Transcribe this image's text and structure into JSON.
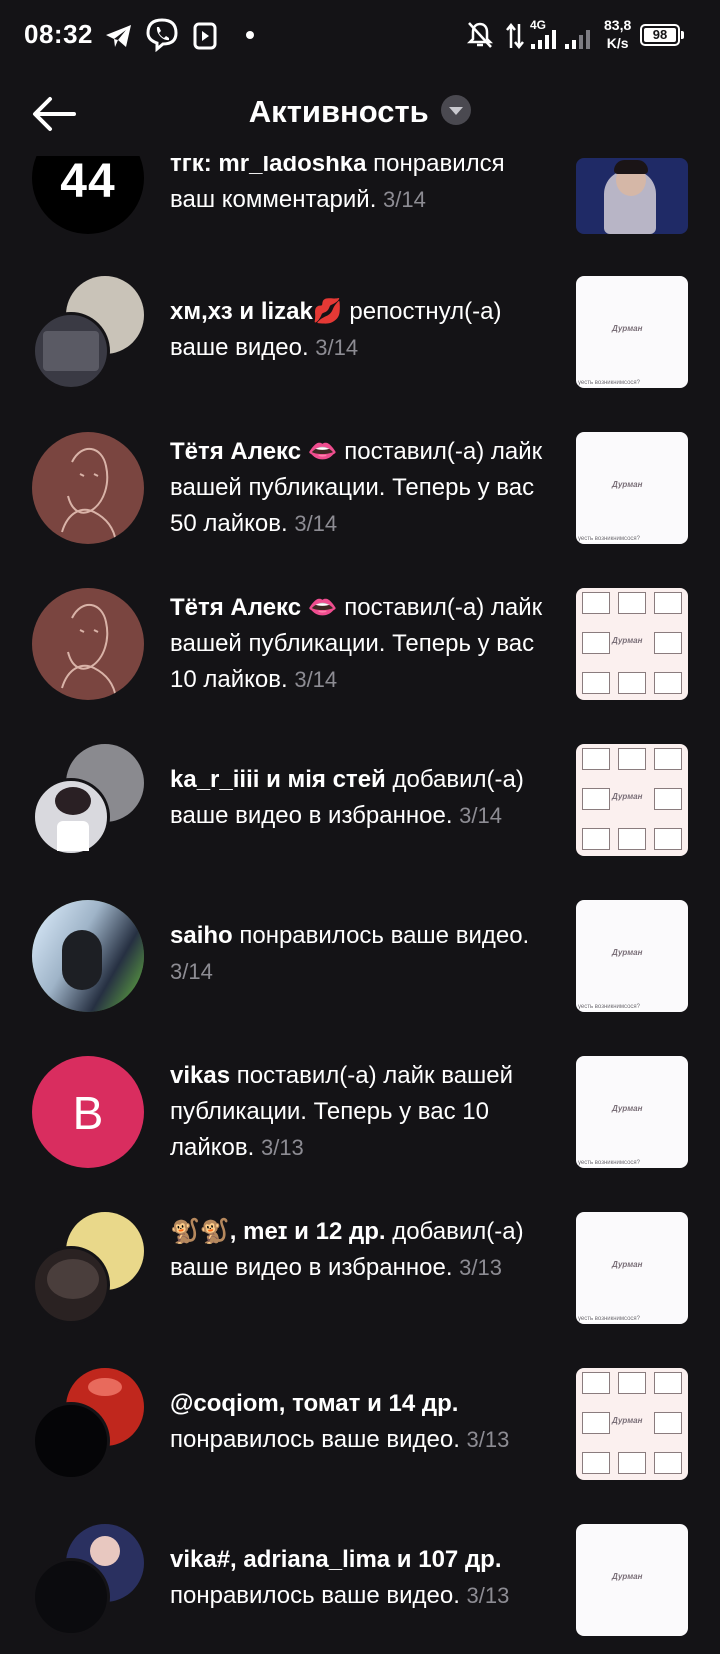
{
  "status_bar": {
    "time": "08:32",
    "network": "4G",
    "speed_value": "83,8",
    "speed_unit": "K/s",
    "battery": "98",
    "icons": [
      "telegram-icon",
      "viber-icon",
      "media-icon",
      "dot-icon",
      "mute-icon",
      "data-arrows-icon",
      "signal-icon",
      "signal-icon-2",
      "battery-icon"
    ]
  },
  "header": {
    "title": "Активность",
    "back_icon": "arrow-left-icon",
    "dropdown_icon": "caret-down-icon"
  },
  "colors": {
    "background": "#141316",
    "date_gray": "#8d8c93",
    "avatar_pink": "#d92d5f"
  },
  "notifications": [
    {
      "user": "тгк: mr_ladoshka",
      "action": " понравился ваш комментарий.",
      "date": "3/14",
      "avatar_text": "44"
    },
    {
      "user": "хм,хз и lizak💋",
      "action": " репостнул(-а) ваше видео.",
      "date": "3/14"
    },
    {
      "user": "Тётя Алекс 👄",
      "action": " поставил(-а) лайк вашей публикации. Теперь у вас 50 лайков.",
      "date": "3/14"
    },
    {
      "user": "Тётя Алекс 👄",
      "action": " поставил(-а) лайк вашей публикации. Теперь у вас 10 лайков.",
      "date": "3/14"
    },
    {
      "user": "ka_r_iiii и мія стей",
      "action": " добавил(-а) ваше видео в избранное.",
      "date": "3/14"
    },
    {
      "user": "saiho",
      "action": " понравилось ваше видео.",
      "date": "3/14"
    },
    {
      "user": "vikas",
      "action": " поставил(-а) лайк вашей публикации. Теперь у вас 10 лайков.",
      "date": "3/13",
      "avatar_text": "B"
    },
    {
      "user": "🐒🐒, meɪ и 12 др.",
      "action": " добавил(-а) ваше видео в избранное.",
      "date": "3/13"
    },
    {
      "user": "@coqiom, томат и 14 др.",
      "action": " понравилось ваше видео.",
      "date": "3/13"
    },
    {
      "user": "vika#, adriana_lima и 107 др.",
      "action": " понравилось ваше видео.",
      "date": "3/13"
    }
  ],
  "thumb_text": {
    "logo": "Дурман",
    "caption": "уесть возникнимсося?"
  }
}
